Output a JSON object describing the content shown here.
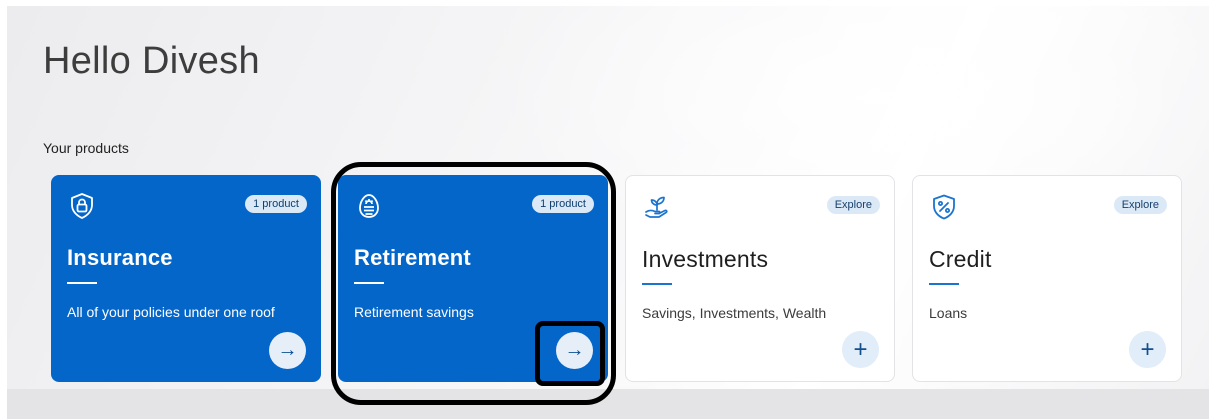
{
  "greeting": "Hello Divesh",
  "section_label": "Your products",
  "cards": [
    {
      "title": "Insurance",
      "subtitle": "All of your policies under one roof",
      "badge": "1 product",
      "icon": "shield-lock-icon",
      "action": "→"
    },
    {
      "title": "Retirement",
      "subtitle": "Retirement savings",
      "badge": "1 product",
      "icon": "retirement-egg-icon",
      "action": "→"
    },
    {
      "title": "Investments",
      "subtitle": "Savings, Investments, Wealth",
      "badge": "Explore",
      "icon": "plant-hand-icon",
      "action": "+"
    },
    {
      "title": "Credit",
      "subtitle": "Loans",
      "badge": "Explore",
      "icon": "percent-shield-icon",
      "action": "+"
    }
  ],
  "colors": {
    "brand_blue": "#0366c8",
    "badge_bg": "#dbe9f7",
    "highlight": "#000000"
  }
}
